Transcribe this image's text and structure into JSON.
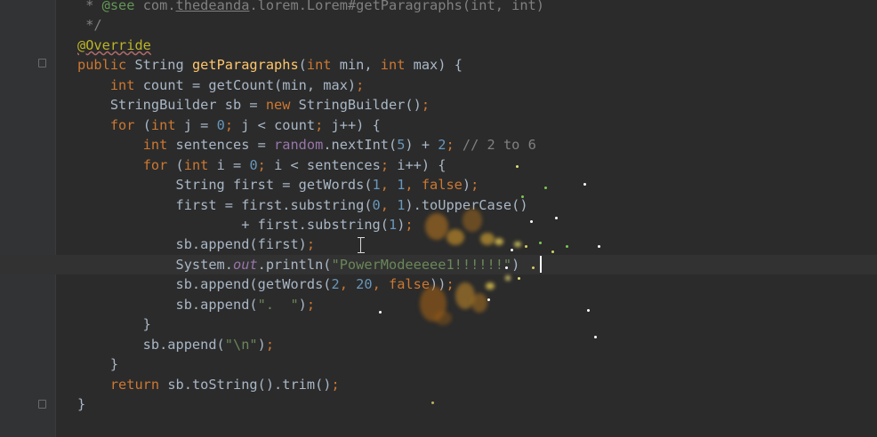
{
  "editor": {
    "language": "java",
    "current_line_index": 13,
    "lines": [
      [
        {
          "t": " * ",
          "c": "t-comment"
        },
        {
          "t": "@see",
          "c": "t-doc"
        },
        {
          "t": " com.",
          "c": "t-comment"
        },
        {
          "t": "thedeanda",
          "c": "t-comment t-uline"
        },
        {
          "t": ".lorem.Lorem#getParagraphs(int, int)",
          "c": "t-comment"
        }
      ],
      [
        {
          "t": " */",
          "c": "t-comment"
        }
      ],
      [
        {
          "t": "@Override",
          "c": "t-ann t-squig"
        }
      ],
      [
        {
          "t": "public ",
          "c": "t-kw"
        },
        {
          "t": "String ",
          "c": "t-plain"
        },
        {
          "t": "getParagraphs",
          "c": "t-fn"
        },
        {
          "t": "(",
          "c": "t-plain"
        },
        {
          "t": "int ",
          "c": "t-kw"
        },
        {
          "t": "min, ",
          "c": "t-plain"
        },
        {
          "t": "int ",
          "c": "t-kw"
        },
        {
          "t": "max) {",
          "c": "t-plain"
        }
      ],
      [
        {
          "t": "    ",
          "c": "t-plain"
        },
        {
          "t": "int ",
          "c": "t-kw"
        },
        {
          "t": "count = getCount(min, max)",
          "c": "t-plain"
        },
        {
          "t": ";",
          "c": "t-kw"
        }
      ],
      [
        {
          "t": "    StringBuilder sb = ",
          "c": "t-plain"
        },
        {
          "t": "new ",
          "c": "t-kw"
        },
        {
          "t": "StringBuilder()",
          "c": "t-plain"
        },
        {
          "t": ";",
          "c": "t-kw"
        }
      ],
      [
        {
          "t": "    ",
          "c": "t-plain"
        },
        {
          "t": "for ",
          "c": "t-kw"
        },
        {
          "t": "(",
          "c": "t-plain"
        },
        {
          "t": "int ",
          "c": "t-kw"
        },
        {
          "t": "j = ",
          "c": "t-plain"
        },
        {
          "t": "0",
          "c": "t-num"
        },
        {
          "t": "; ",
          "c": "t-kw"
        },
        {
          "t": "j < count",
          "c": "t-plain"
        },
        {
          "t": "; ",
          "c": "t-kw"
        },
        {
          "t": "j++) {",
          "c": "t-plain"
        }
      ],
      [
        {
          "t": "        ",
          "c": "t-plain"
        },
        {
          "t": "int ",
          "c": "t-kw"
        },
        {
          "t": "sentences = ",
          "c": "t-plain"
        },
        {
          "t": "random",
          "c": "t-field"
        },
        {
          "t": ".nextInt(",
          "c": "t-plain"
        },
        {
          "t": "5",
          "c": "t-num"
        },
        {
          "t": ") + ",
          "c": "t-plain"
        },
        {
          "t": "2",
          "c": "t-num"
        },
        {
          "t": "; ",
          "c": "t-kw"
        },
        {
          "t": "// 2 to 6",
          "c": "t-comment"
        }
      ],
      [
        {
          "t": "        ",
          "c": "t-plain"
        },
        {
          "t": "for ",
          "c": "t-kw"
        },
        {
          "t": "(",
          "c": "t-plain"
        },
        {
          "t": "int ",
          "c": "t-kw"
        },
        {
          "t": "i = ",
          "c": "t-plain"
        },
        {
          "t": "0",
          "c": "t-num"
        },
        {
          "t": "; ",
          "c": "t-kw"
        },
        {
          "t": "i < sentences",
          "c": "t-plain"
        },
        {
          "t": "; ",
          "c": "t-kw"
        },
        {
          "t": "i++) {",
          "c": "t-plain"
        }
      ],
      [
        {
          "t": "            String first = getWords(",
          "c": "t-plain"
        },
        {
          "t": "1",
          "c": "t-num"
        },
        {
          "t": ", ",
          "c": "t-kw"
        },
        {
          "t": "1",
          "c": "t-num"
        },
        {
          "t": ", ",
          "c": "t-kw"
        },
        {
          "t": "false",
          "c": "t-kw"
        },
        {
          "t": ")",
          "c": "t-plain"
        },
        {
          "t": ";",
          "c": "t-kw"
        }
      ],
      [
        {
          "t": "            first = first.substring(",
          "c": "t-plain"
        },
        {
          "t": "0",
          "c": "t-num"
        },
        {
          "t": ", ",
          "c": "t-kw"
        },
        {
          "t": "1",
          "c": "t-num"
        },
        {
          "t": ").toUpperCase()",
          "c": "t-plain"
        }
      ],
      [
        {
          "t": "                    + first.substring(",
          "c": "t-plain"
        },
        {
          "t": "1",
          "c": "t-num"
        },
        {
          "t": ")",
          "c": "t-plain"
        },
        {
          "t": ";",
          "c": "t-kw"
        }
      ],
      [
        {
          "t": "            sb.append(first)",
          "c": "t-plain"
        },
        {
          "t": ";",
          "c": "t-kw"
        }
      ],
      [
        {
          "t": "            System.",
          "c": "t-plain"
        },
        {
          "t": "out",
          "c": "t-static"
        },
        {
          "t": ".println(",
          "c": "t-plain"
        },
        {
          "t": "\"PowerModeeeee1!!!!!!\"",
          "c": "t-str"
        },
        {
          "t": ")",
          "c": "t-plain"
        }
      ],
      [
        {
          "t": "            sb.append(getWords(",
          "c": "t-plain"
        },
        {
          "t": "2",
          "c": "t-num"
        },
        {
          "t": ", ",
          "c": "t-kw"
        },
        {
          "t": "20",
          "c": "t-num"
        },
        {
          "t": ", ",
          "c": "t-kw"
        },
        {
          "t": "false",
          "c": "t-kw"
        },
        {
          "t": "))",
          "c": "t-plain"
        },
        {
          "t": ";",
          "c": "t-kw"
        }
      ],
      [
        {
          "t": "            sb.append(",
          "c": "t-plain"
        },
        {
          "t": "\".  \"",
          "c": "t-str"
        },
        {
          "t": ")",
          "c": "t-plain"
        },
        {
          "t": ";",
          "c": "t-kw"
        }
      ],
      [
        {
          "t": "        }",
          "c": "t-plain"
        }
      ],
      [
        {
          "t": "        sb.append(",
          "c": "t-plain"
        },
        {
          "t": "\"\\n\"",
          "c": "t-str"
        },
        {
          "t": ")",
          "c": "t-plain"
        },
        {
          "t": ";",
          "c": "t-kw"
        }
      ],
      [
        {
          "t": "    }",
          "c": "t-plain"
        }
      ],
      [
        {
          "t": "    ",
          "c": "t-plain"
        },
        {
          "t": "return ",
          "c": "t-kw"
        },
        {
          "t": "sb.toString().trim()",
          "c": "t-plain"
        },
        {
          "t": ";",
          "c": "t-kw"
        }
      ],
      [
        {
          "t": "}",
          "c": "t-plain"
        }
      ]
    ]
  },
  "colors": {
    "background": "#2b2b2b",
    "gutter": "#313335",
    "keyword": "#cc7832",
    "annotation": "#bbb529",
    "method": "#ffc66d",
    "number": "#6897bb",
    "string": "#6a8759",
    "comment": "#808080",
    "field": "#9876aa",
    "text": "#a9b7c6"
  },
  "effects": {
    "name": "power-mode particles"
  }
}
